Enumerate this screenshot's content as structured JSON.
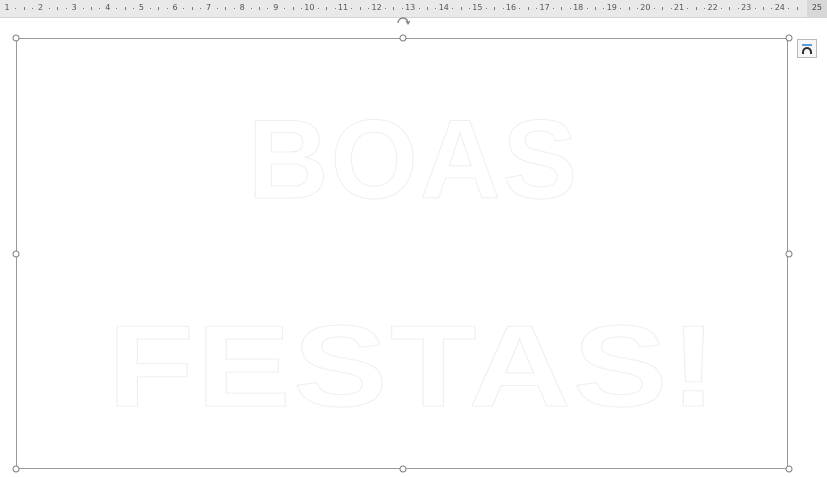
{
  "ruler": {
    "numbers": [
      "1",
      "2",
      "3",
      "4",
      "5",
      "6",
      "7",
      "8",
      "9",
      "10",
      "11",
      "12",
      "13",
      "14",
      "15",
      "16",
      "17",
      "18",
      "19",
      "20",
      "21",
      "22",
      "23",
      "24"
    ],
    "end_label": "25"
  },
  "wordart": {
    "line1": "BOAS",
    "line2": "FESTAS!",
    "fill_color": "#ffffff",
    "outline_color": "#efefef"
  },
  "selection": {
    "border_color": "#9a9a9a",
    "handle_color": "#ffffff"
  },
  "icons": {
    "rotate": "rotate-icon",
    "layout_options": "layout-options-icon"
  }
}
